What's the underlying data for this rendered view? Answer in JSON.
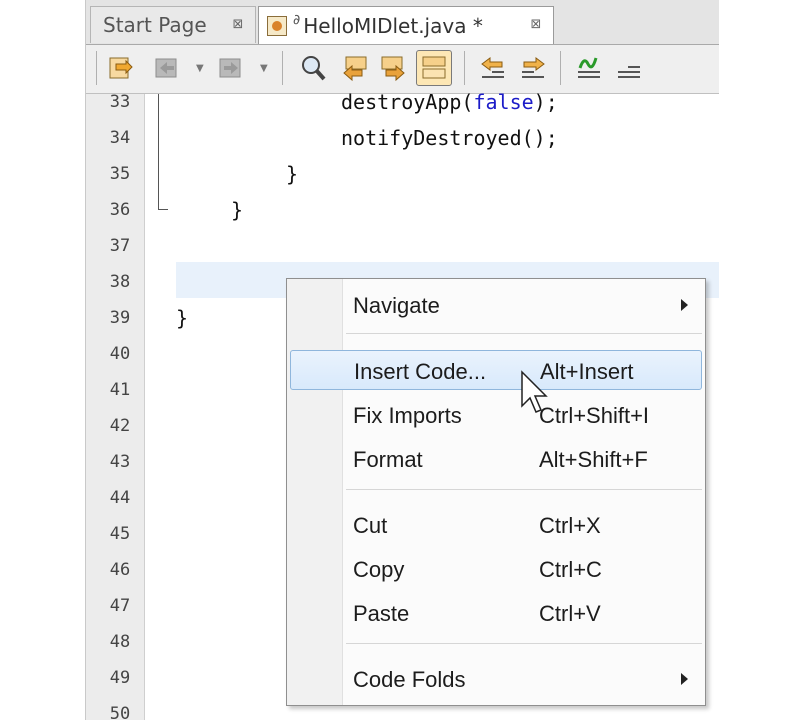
{
  "tabs": [
    {
      "label": "Start Page",
      "active": false
    },
    {
      "label": "HelloMIDlet.java *",
      "active": true
    }
  ],
  "toolbar": {
    "icons": [
      "last-edit-icon",
      "back-icon",
      "forward-icon",
      "find-selection-icon",
      "find-previous-icon",
      "find-next-icon",
      "toggle-highlight-icon",
      "shift-left-icon",
      "shift-right-icon",
      "start-macro-icon",
      "stop-macro-icon"
    ]
  },
  "editor": {
    "line_numbers": [
      "33",
      "34",
      "35",
      "36",
      "37",
      "38",
      "39",
      "40",
      "41",
      "42",
      "43",
      "44",
      "45",
      "46",
      "47",
      "48",
      "49",
      "50"
    ],
    "code": {
      "l33_pre": "destroyApp(",
      "l33_kw": "false",
      "l33_post": ");",
      "l34": "notifyDestroyed();",
      "l35": "}",
      "l36": "}",
      "l39": "}"
    }
  },
  "context_menu": {
    "items": [
      {
        "label": "Navigate",
        "shortcut": "",
        "submenu": true
      },
      {
        "label": "Insert Code...",
        "shortcut": "Alt+Insert",
        "selected": true
      },
      {
        "label": "Fix Imports",
        "shortcut": "Ctrl+Shift+I"
      },
      {
        "label": "Format",
        "shortcut": "Alt+Shift+F"
      },
      {
        "label": "Cut",
        "shortcut": "Ctrl+X"
      },
      {
        "label": "Copy",
        "shortcut": "Ctrl+C"
      },
      {
        "label": "Paste",
        "shortcut": "Ctrl+V"
      },
      {
        "label": "Code Folds",
        "shortcut": "",
        "submenu": true
      }
    ]
  },
  "colors": {
    "keyword": "#1b1bc8",
    "current_line": "#e8f1fb",
    "menu_selection": "#d8e9fb"
  }
}
